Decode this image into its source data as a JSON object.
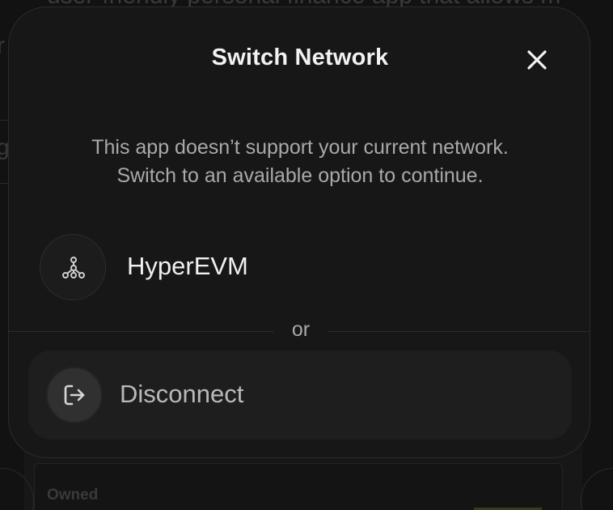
{
  "background": {
    "text_line_1": "user-friendly personal finance app that allows m",
    "text_line_2": "r",
    "side_glyph": "g",
    "card_label": "Owned"
  },
  "modal": {
    "title": "Switch Network",
    "close_icon": "close-icon",
    "description_line_1": "This app doesn’t support your current network.",
    "description_line_2": "Switch to an available option to continue.",
    "network": {
      "icon": "network-nodes-icon",
      "label": "HyperEVM"
    },
    "divider_text": "or",
    "disconnect": {
      "icon": "logout-icon",
      "label": "Disconnect"
    }
  },
  "colors": {
    "modal_bg": "#161716",
    "title": "#f2f2f2",
    "muted_text": "#a9a9a9",
    "disconnect_bg": "#1d1e1d"
  }
}
